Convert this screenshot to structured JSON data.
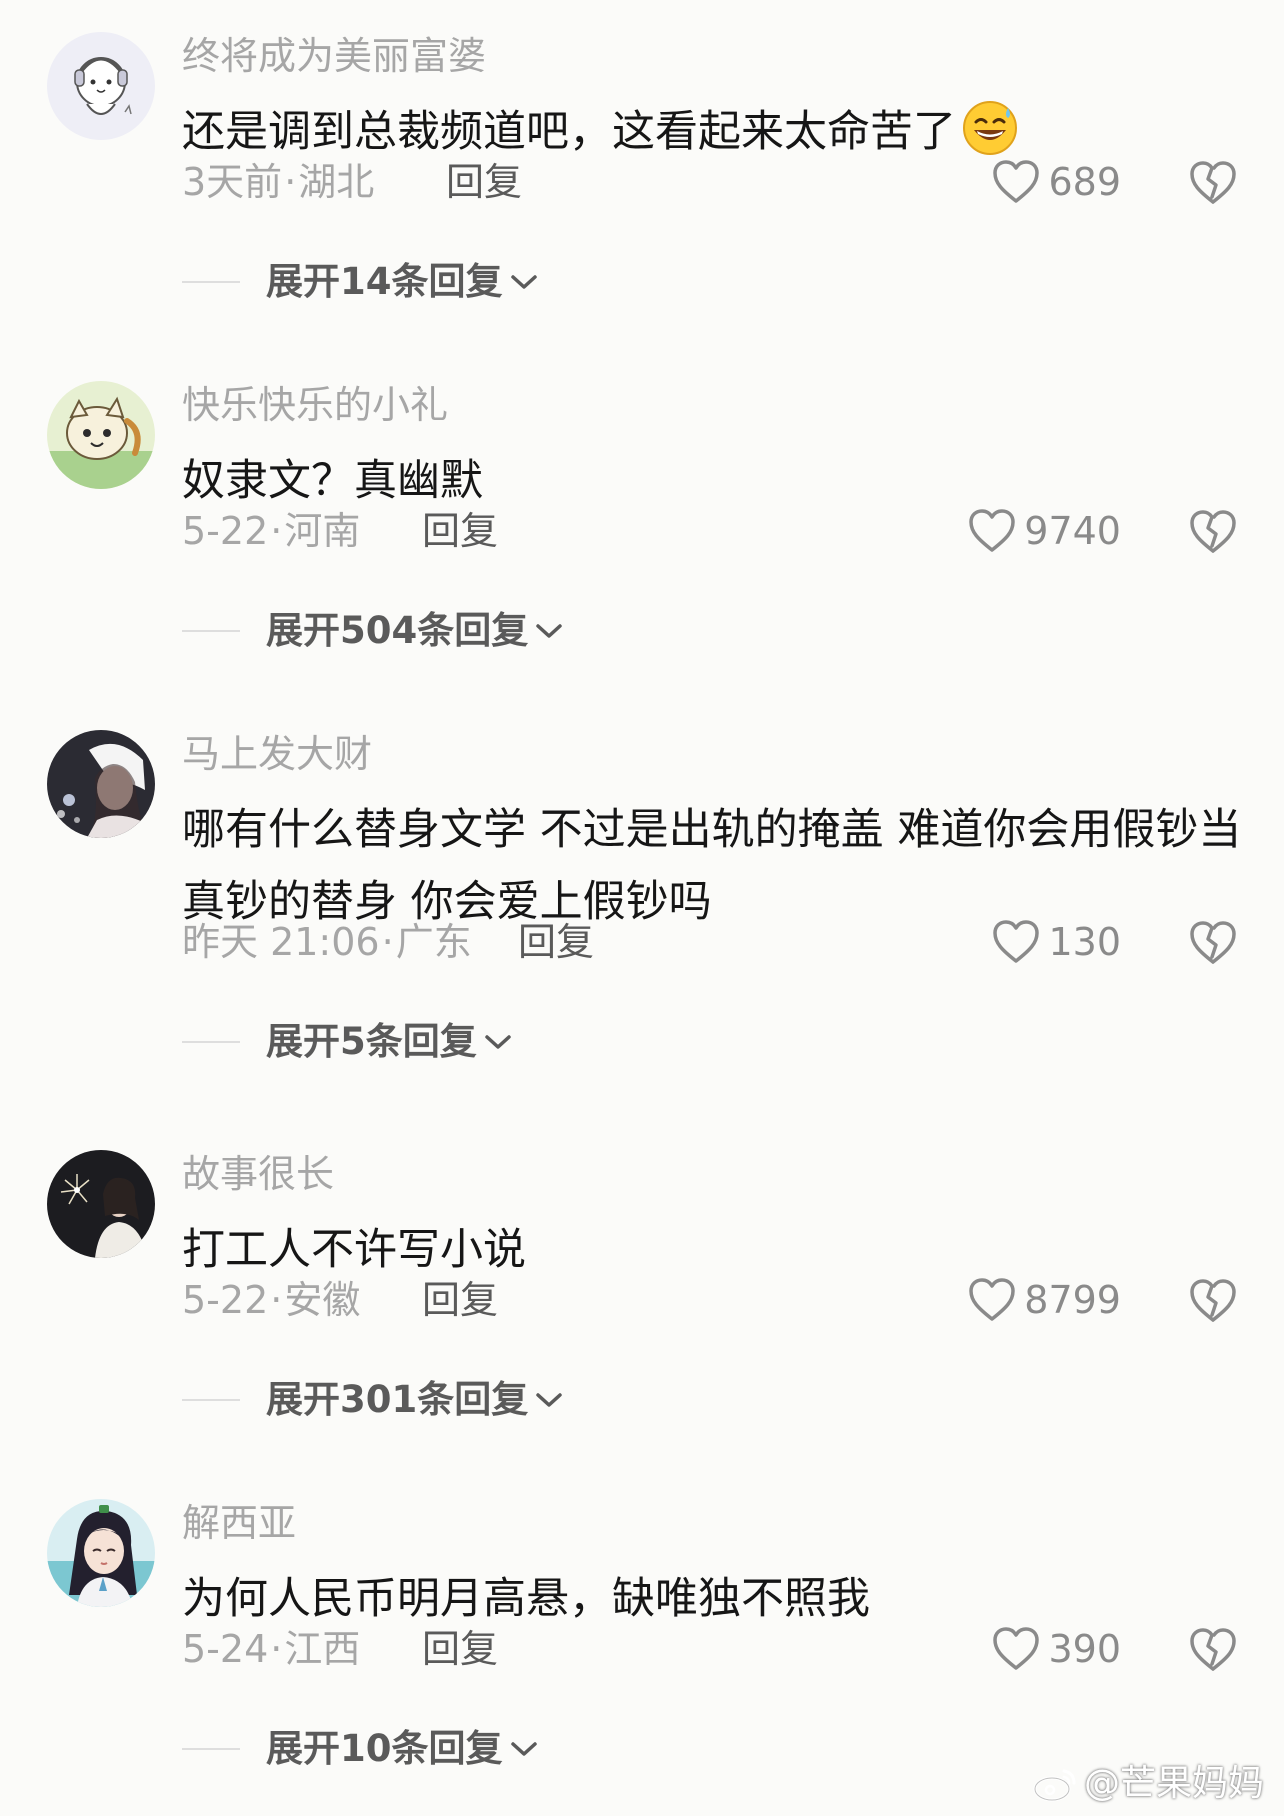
{
  "comments": [
    {
      "username": "终将成为美丽富婆",
      "text": "还是调到总裁频道吧，这看起来太命苦了",
      "emoji": "grinning-sweat-emoji",
      "date": "3天前",
      "location": "湖北",
      "reply_label": "回复",
      "likes": "689",
      "expand_label": "展开14条回复"
    },
    {
      "username": "快乐快乐的小礼",
      "text": "奴隶文？真幽默",
      "date": "5-22",
      "location": "河南",
      "reply_label": "回复",
      "likes": "9740",
      "expand_label": "展开504条回复"
    },
    {
      "username": "马上发大财",
      "text": "哪有什么替身文学 不过是出轨的掩盖 难道你会用假钞当真钞的替身 你会爱上假钞吗",
      "date": "昨天 21:06",
      "location": "广东",
      "reply_label": "回复",
      "likes": "130",
      "expand_label": "展开5条回复"
    },
    {
      "username": "故事很长",
      "text": "打工人不许写小说",
      "date": "5-22",
      "location": "安徽",
      "reply_label": "回复",
      "likes": "8799",
      "expand_label": "展开301条回复"
    },
    {
      "username": "解西亚",
      "text": "为何人民币明月高悬，缺唯独不照我",
      "date": "5-24",
      "location": "江西",
      "reply_label": "回复",
      "likes": "390",
      "expand_label": "展开10条回复"
    }
  ],
  "separator": "·",
  "icons": {
    "like": "heart-outline-icon",
    "dislike": "broken-heart-icon",
    "expand": "chevron-down-icon"
  },
  "watermark": {
    "text": "@芒果妈妈",
    "icon": "weibo-logo-icon"
  },
  "colors": {
    "background": "#fbfbf9",
    "text": "#161616",
    "muted": "#a6a6a6",
    "reply": "#5a5a5a"
  }
}
